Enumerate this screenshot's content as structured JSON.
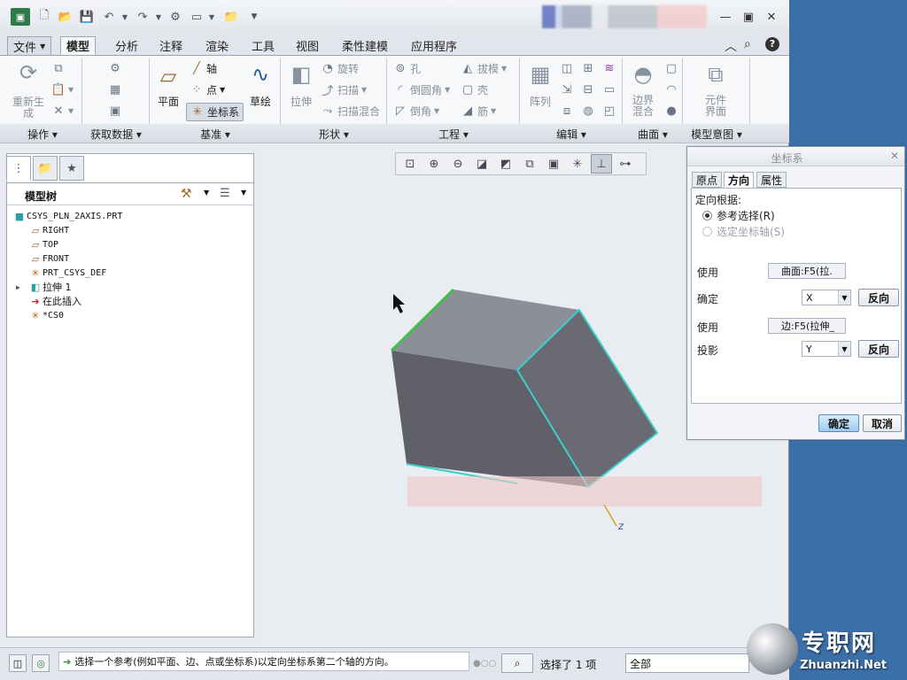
{
  "menu": {
    "file": "文件",
    "tabs": [
      "模型",
      "分析",
      "注释",
      "渲染",
      "工具",
      "视图",
      "柔性建模",
      "应用程序"
    ]
  },
  "ribbon": {
    "operations": {
      "regenerate": "重新生\n成",
      "group": "操作"
    },
    "get_data": {
      "group": "获取数据"
    },
    "datum": {
      "plane": "平面",
      "axis": "轴",
      "point": "点",
      "csys": "坐标系",
      "sketch": "草绘",
      "group": "基准"
    },
    "shapes": {
      "extrude": "拉伸",
      "revolve": "旋转",
      "sweep": "扫描",
      "swept_blend": "扫描混合",
      "group": "形状"
    },
    "engineering": {
      "hole": "孔",
      "draft": "拔模",
      "round": "倒圆角",
      "shell": "壳",
      "chamfer": "倒角",
      "rib": "筋",
      "group": "工程"
    },
    "editing": {
      "pattern": "阵列",
      "group": "编辑"
    },
    "surfaces": {
      "boundary_blend": "边界\n混合",
      "group": "曲面"
    },
    "model_intent": {
      "component_interface": "元件\n界面",
      "group": "模型意图"
    }
  },
  "model_tree": {
    "title": "模型树",
    "items": [
      {
        "icon": "part-icon",
        "label": "CSYS_PLN_2AXIS.PRT"
      },
      {
        "icon": "datum-plane-icon",
        "label": "RIGHT"
      },
      {
        "icon": "datum-plane-icon",
        "label": "TOP"
      },
      {
        "icon": "datum-plane-icon",
        "label": "FRONT"
      },
      {
        "icon": "csys-icon",
        "label": "PRT_CSYS_DEF"
      },
      {
        "icon": "extrude-icon",
        "label": "拉伸 1"
      },
      {
        "icon": "insert-here-icon",
        "label": "在此插入"
      },
      {
        "icon": "csys-icon",
        "label": "*CS0"
      }
    ]
  },
  "dialog": {
    "title": "坐标系",
    "tabs": [
      "原点",
      "方向",
      "属性"
    ],
    "orient_by": "定向根据:",
    "opt_ref": "参考选择(R)",
    "opt_axis": "选定坐标轴(S)",
    "use1_label": "使用",
    "use1_value": "曲面:F5(拉.",
    "determine_label": "确定",
    "determine_value": "X",
    "flip1": "反向",
    "use2_label": "使用",
    "use2_value": "边:F5(拉伸_",
    "project_label": "投影",
    "project_value": "Y",
    "flip2": "反向",
    "ok": "确定",
    "cancel": "取消"
  },
  "graphics": {
    "axis_label": "Z"
  },
  "status": {
    "message": "选择一个参考(例如平面、边、点或坐标系)以定向坐标系第二个轴的方向。",
    "selected": "选择了 1 项",
    "filter": "全部"
  },
  "watermark": {
    "cn": "专职网",
    "en": "Zhuanzhi.Net"
  }
}
